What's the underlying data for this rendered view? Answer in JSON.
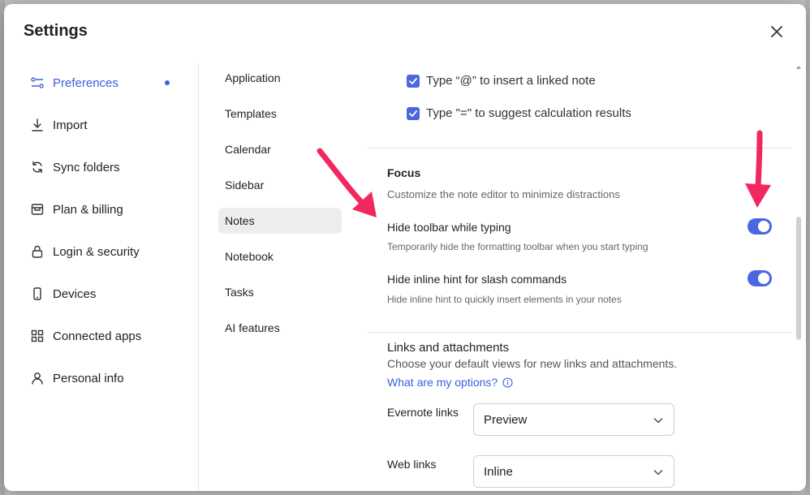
{
  "window": {
    "title": "Settings"
  },
  "nav": {
    "items": [
      {
        "label": "Preferences",
        "icon": "sliders-icon",
        "active": true
      },
      {
        "label": "Import",
        "icon": "download-icon"
      },
      {
        "label": "Sync folders",
        "icon": "sync-icon"
      },
      {
        "label": "Plan & billing",
        "icon": "billing-icon"
      },
      {
        "label": "Login & security",
        "icon": "lock-icon"
      },
      {
        "label": "Devices",
        "icon": "phone-icon"
      },
      {
        "label": "Connected apps",
        "icon": "grid-icon"
      },
      {
        "label": "Personal info",
        "icon": "person-icon"
      }
    ]
  },
  "subnav": {
    "items": [
      {
        "label": "Application"
      },
      {
        "label": "Templates"
      },
      {
        "label": "Calendar"
      },
      {
        "label": "Sidebar"
      },
      {
        "label": "Notes",
        "active": true
      },
      {
        "label": "Notebook"
      },
      {
        "label": "Tasks"
      },
      {
        "label": "AI features"
      }
    ]
  },
  "content": {
    "checkboxes": [
      {
        "label": "Type “@” to insert a linked note",
        "checked": true
      },
      {
        "label": "Type \"=\" to suggest calculation results",
        "checked": true
      }
    ],
    "focus": {
      "title": "Focus",
      "subtitle": "Customize the note editor to minimize distractions",
      "toggles": [
        {
          "label": "Hide toolbar while typing",
          "description": "Temporarily hide the formatting toolbar when you start typing",
          "on": true
        },
        {
          "label": "Hide inline hint for slash commands",
          "description": "Hide inline hint to quickly insert elements in your notes",
          "on": true
        }
      ]
    },
    "links": {
      "title": "Links and attachments",
      "subtitle": "Choose your default views for new links and attachments.",
      "help_link": "What are my options?",
      "evernote_links": {
        "label": "Evernote links",
        "value": "Preview"
      },
      "web_links": {
        "label": "Web links",
        "value": "Inline"
      }
    }
  },
  "colors": {
    "accent": "#4a67e0",
    "annotation": "#f0285f"
  }
}
